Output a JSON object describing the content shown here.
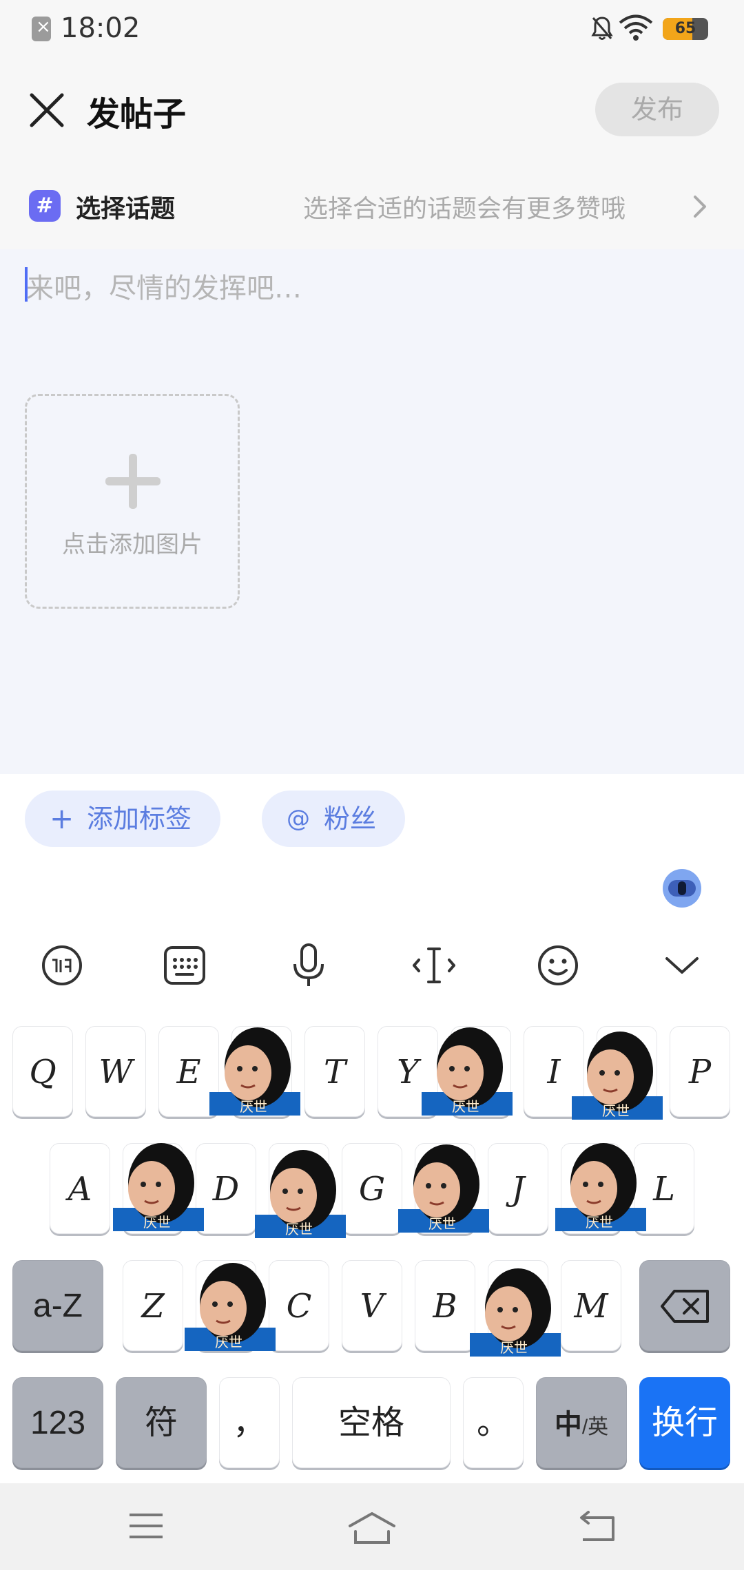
{
  "status": {
    "time": "18:02",
    "battery_level": 65,
    "battery_text": "65"
  },
  "header": {
    "title": "发帖子",
    "publish_label": "发布"
  },
  "topic": {
    "label": "选择话题",
    "hint": "选择合适的话题会有更多赞哦",
    "icon": "#"
  },
  "editor": {
    "placeholder": "来吧，尽情的发挥吧…",
    "add_image_label": "点击添加图片"
  },
  "chips": {
    "add_tag_label": "添加标签",
    "add_tag_icon": "+",
    "fans_label": "粉丝",
    "fans_icon": "@"
  },
  "keyboard": {
    "row1": [
      "Q",
      "W",
      "E",
      "T",
      "Y",
      "I",
      "P"
    ],
    "row2": [
      "A",
      "D",
      "G",
      "J",
      "L"
    ],
    "row3": [
      "a-Z",
      "Z",
      "C",
      "V",
      "B",
      "M"
    ],
    "row4": {
      "num": "123",
      "sym": "符",
      "comma": "，",
      "space": "空格",
      "period": "。",
      "lang_main": "中",
      "lang_sub": "/英",
      "enter": "换行"
    }
  },
  "sticker_text": "厌世",
  "colors": {
    "accent": "#1a73f5",
    "chip_text": "#5b7de0",
    "topic_icon": "#6b6cf2"
  },
  "icons": [
    "close-icon",
    "chevron-right-icon",
    "hash-icon",
    "plus-icon",
    "at-icon",
    "keyboard-icon",
    "mic-icon",
    "cursor-icon",
    "emoji-icon",
    "collapse-icon",
    "backspace-icon",
    "menu-icon",
    "home-icon",
    "back-icon"
  ]
}
